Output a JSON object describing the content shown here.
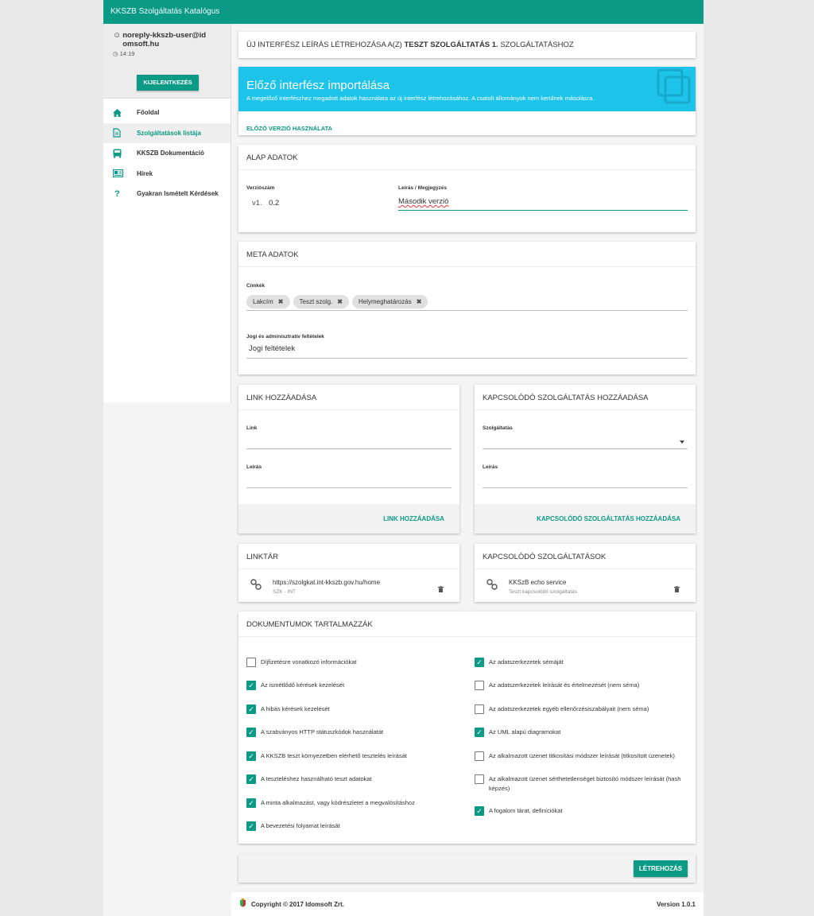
{
  "app": {
    "title": "KKSZB Szolgáltatás Katalógus"
  },
  "user": {
    "email": "noreply-kkszb-user@idomsoft.hu",
    "time": "14:19",
    "logout_label": "KIJELENTKEZÉS"
  },
  "sidebar": {
    "items": [
      {
        "label": "Főoldal",
        "icon": "home-icon"
      },
      {
        "label": "Szolgáltatások listája",
        "icon": "document-icon",
        "active": true
      },
      {
        "label": "KKSZB Dokumentáció",
        "icon": "bus-icon"
      },
      {
        "label": "Hírek",
        "icon": "news-icon"
      },
      {
        "label": "Gyakran Ismételt Kérdések",
        "icon": "question-icon"
      }
    ]
  },
  "header": {
    "prefix": "ÚJ INTERFÉSZ LEÍRÁS LÉTREHOZÁSA A(Z) ",
    "service": "TESZT SZOLGÁLTATÁS 1.",
    "suffix": " SZOLGÁLTATÁSHOZ"
  },
  "import": {
    "title": "Előző interfész importálása",
    "desc": "A megelőző interfészhez megadott adatok használata az új interfész létrehozásához. A csatolt állományok nem kerülnek másolásra.",
    "action": "ELŐZŐ VERZIÓ HASZNÁLATA",
    "accent": "#1ec3ea"
  },
  "basic": {
    "title": "ALAP ADATOK",
    "version_label": "Verziószám",
    "version_prefix": "v1.",
    "version_value": "0.2",
    "desc_label": "Leírás / Megjegyzés",
    "desc_value": "Második verzió"
  },
  "meta": {
    "title": "META ADATOK",
    "tags_label": "Címkék",
    "tags": [
      "Lakcím",
      "Teszt szolg.",
      "Helymeghatározás"
    ],
    "legal_label": "Jogi és adminisztratív feltételek",
    "legal_value": "Jogi feltételek"
  },
  "link_add": {
    "title": "LINK HOZZÁADÁSA",
    "link_label": "Link",
    "desc_label": "Leírás",
    "button": "LINK HOZZÁADÁSA"
  },
  "related_add": {
    "title": "KAPCSOLÓDÓ SZOLGÁLTATÁS HOZZÁADÁSA",
    "service_label": "Szolgáltatás",
    "desc_label": "Leírás",
    "button": "KAPCSOLÓDÓ SZOLGÁLTATÁS HOZZÁADÁSA"
  },
  "linktar": {
    "title": "LINKTÁR",
    "item_url": "https://szolgkat.int-kkszb.gov.hu/home",
    "item_sub": "SZK - INT"
  },
  "related_list": {
    "title": "KAPCSOLÓDÓ SZOLGÁLTATÁSOK",
    "item_name": "KKSzB echo service",
    "item_sub": "Teszt kapcsolódó szolgáltatás"
  },
  "docs": {
    "title": "DOKUMENTUMOK TARTALMAZZÁK",
    "left": [
      {
        "label": "Díjfizetésre vonatkozó információkat",
        "checked": false
      },
      {
        "label": "Az ismétlődő kérések kezelését",
        "checked": true
      },
      {
        "label": "A hibás kérések kezelését",
        "checked": true
      },
      {
        "label": "A szabványos HTTP státuszkódok használatát",
        "checked": true
      },
      {
        "label": "A KKSZB teszt környezetben elérhető tesztelés leírását",
        "checked": true
      },
      {
        "label": "A teszteléshez használható teszt adatokat",
        "checked": true
      },
      {
        "label": "A minta alkalmazást, vagy kódrészletet a megvalósításhoz",
        "checked": true
      },
      {
        "label": "A bevezetési folyamat leírását",
        "checked": true
      }
    ],
    "right": [
      {
        "label": "Az adatszerkezetek sémáját",
        "checked": true
      },
      {
        "label": "Az adatszerkezetek leírását és értelmezését (nem séma)",
        "checked": false
      },
      {
        "label": "Az adatszerkezetek egyéb ellenőrzésiszabályait (nem séma)",
        "checked": false
      },
      {
        "label": "Az UML alapú diagramokat",
        "checked": true
      },
      {
        "label": "Az alkalmazott üzenet titkosítási módszer leírását (titkosított üzenetek)",
        "checked": false
      },
      {
        "label": "Az alkalmazott üzenet sérthetetlenséget biztosító módszer leírását (hash képzés)",
        "checked": false
      },
      {
        "label": "A fogalom tárat, definíciókat",
        "checked": true
      }
    ]
  },
  "submit": {
    "label": "LÉTREHOZÁS"
  },
  "footer": {
    "copyright": "Copyright © 2017 Idomsoft Zrt.",
    "version": "Version 1.0.1"
  },
  "colors": {
    "primary": "#0a9a86",
    "import_bg": "#1ec3ea"
  }
}
